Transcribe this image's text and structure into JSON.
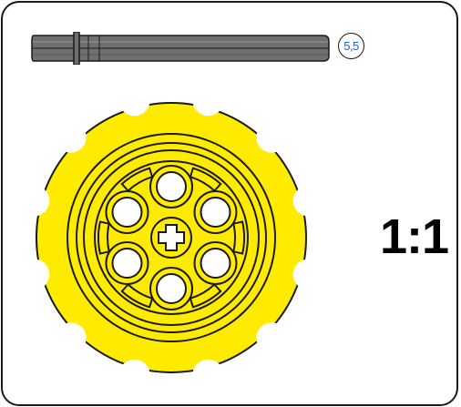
{
  "part": {
    "axle_length_label": "5,5",
    "ratio_label": "1:1",
    "icon": "gear-icon"
  },
  "colors": {
    "gear_fill": "#ffeb00",
    "axle_fill": "#6f6f6f",
    "outline": "#1a1a1a",
    "badge_text": "#1f5fd1"
  }
}
